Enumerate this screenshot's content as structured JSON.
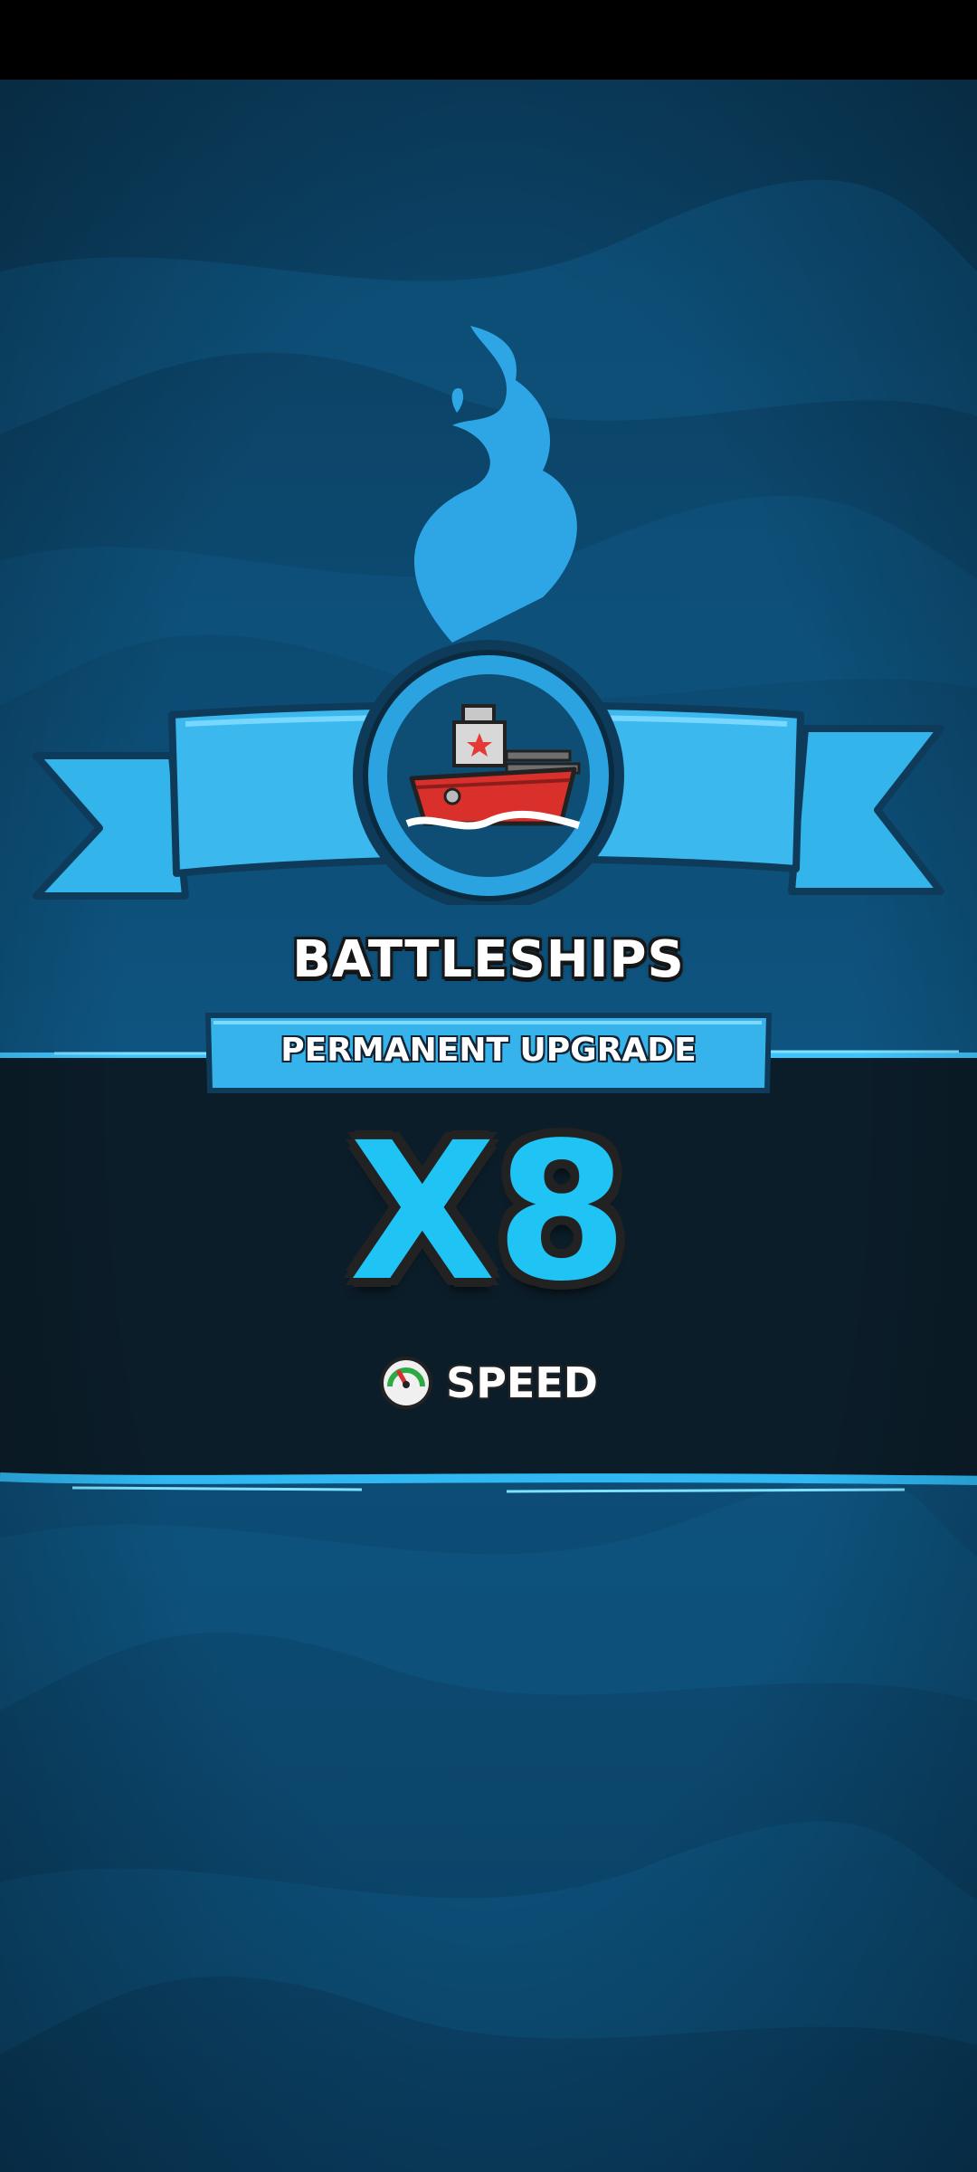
{
  "upgrade": {
    "title": "BATTLESHIPS",
    "subtitle": "PERMANENT UPGRADE",
    "multiplier": "X8",
    "stat_label": "SPEED",
    "stat_icon": "speedometer-icon",
    "unit_icon": "battleship-icon"
  },
  "colors": {
    "background": "#0d4d74",
    "band": "#0b1d29",
    "ribbon": "#33b4ea",
    "accent": "#1fc4f5"
  }
}
